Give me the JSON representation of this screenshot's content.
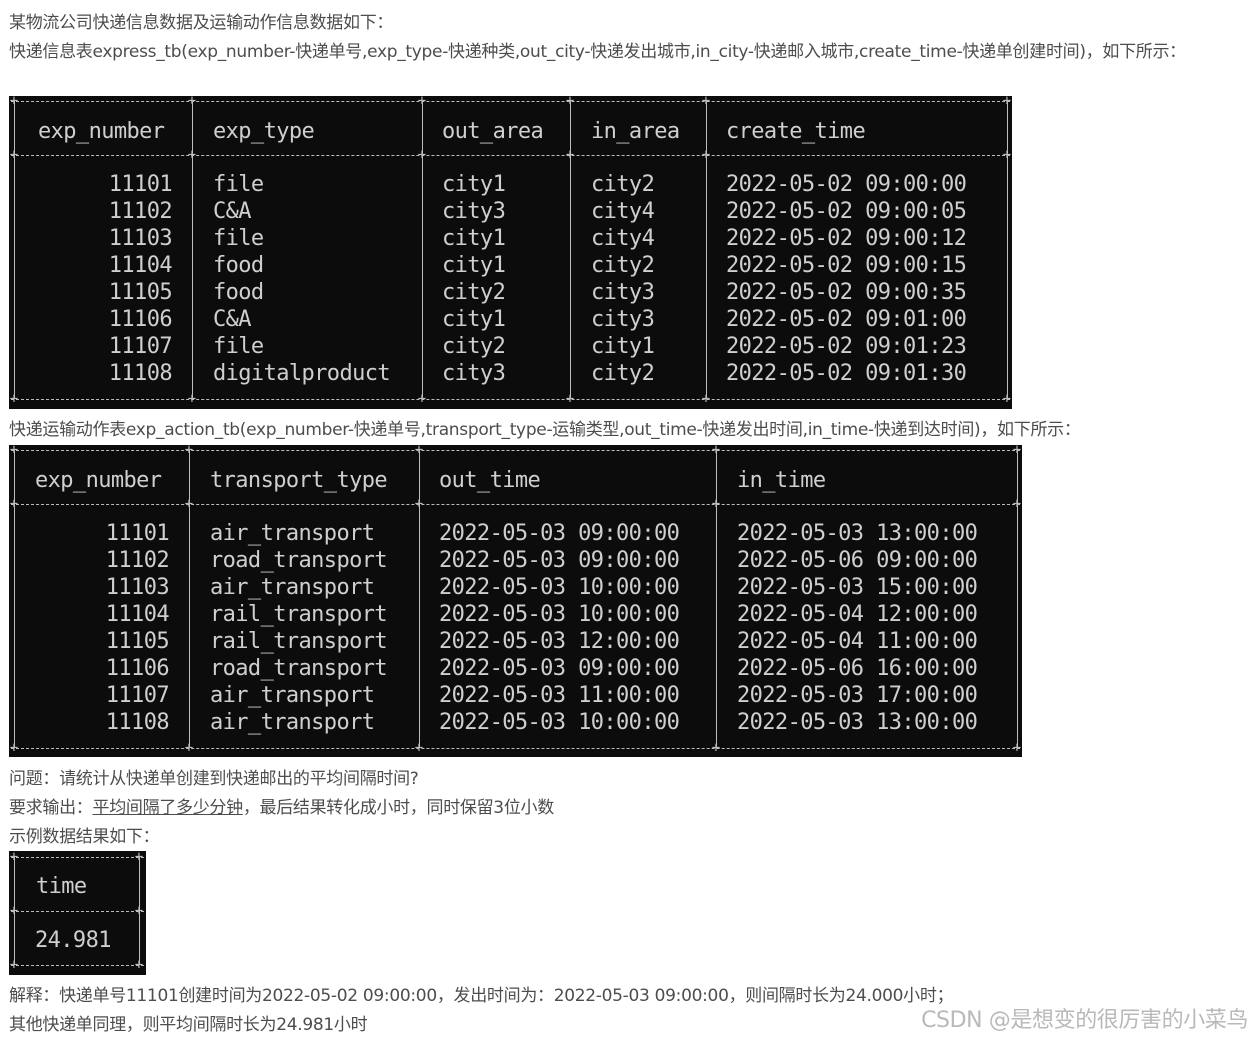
{
  "intro": "某物流公司快递信息数据及运输动作信息数据如下：",
  "express_desc": "快递信息表express_tb(exp_number-快递单号,exp_type-快递种类,out_city-快递发出城市,in_city-快递邮入城市,create_time-快递单创建时间)，如下所示：",
  "express_table": {
    "headers": [
      "exp_number",
      "exp_type",
      "out_area",
      "in_area",
      "create_time"
    ],
    "rows": [
      [
        "11101",
        "file",
        "city1",
        "city2",
        "2022-05-02 09:00:00"
      ],
      [
        "11102",
        "C&A",
        "city3",
        "city4",
        "2022-05-02 09:00:05"
      ],
      [
        "11103",
        "file",
        "city1",
        "city4",
        "2022-05-02 09:00:12"
      ],
      [
        "11104",
        "food",
        "city1",
        "city2",
        "2022-05-02 09:00:15"
      ],
      [
        "11105",
        "food",
        "city2",
        "city3",
        "2022-05-02 09:00:35"
      ],
      [
        "11106",
        "C&A",
        "city1",
        "city3",
        "2022-05-02 09:01:00"
      ],
      [
        "11107",
        "file",
        "city2",
        "city1",
        "2022-05-02 09:01:23"
      ],
      [
        "11108",
        "digitalproduct",
        "city3",
        "city2",
        "2022-05-02 09:01:30"
      ]
    ]
  },
  "action_desc": "快递运输动作表exp_action_tb(exp_number-快递单号,transport_type-运输类型,out_time-快递发出时间,in_time-快递到达时间)，如下所示：",
  "action_table": {
    "headers": [
      "exp_number",
      "transport_type",
      "out_time",
      "in_time"
    ],
    "rows": [
      [
        "11101",
        "air_transport",
        "2022-05-03 09:00:00",
        "2022-05-03 13:00:00"
      ],
      [
        "11102",
        "road_transport",
        "2022-05-03 09:00:00",
        "2022-05-06 09:00:00"
      ],
      [
        "11103",
        "air_transport",
        "2022-05-03 10:00:00",
        "2022-05-03 15:00:00"
      ],
      [
        "11104",
        "rail_transport",
        "2022-05-03 10:00:00",
        "2022-05-04 12:00:00"
      ],
      [
        "11105",
        "rail_transport",
        "2022-05-03 12:00:00",
        "2022-05-04 11:00:00"
      ],
      [
        "11106",
        "road_transport",
        "2022-05-03 09:00:00",
        "2022-05-06 16:00:00"
      ],
      [
        "11107",
        "air_transport",
        "2022-05-03 11:00:00",
        "2022-05-03 17:00:00"
      ],
      [
        "11108",
        "air_transport",
        "2022-05-03 10:00:00",
        "2022-05-03 13:00:00"
      ]
    ]
  },
  "question": "问题：请统计从快递单创建到快递邮出的平均间隔时间?",
  "requirement_prefix": "要求输出：",
  "requirement_underlined": "平均间隔了多少分钟",
  "requirement_suffix": "，最后结果转化成小时，同时保留3位小数",
  "sample_label": "示例数据结果如下：",
  "result_table": {
    "header": "time",
    "value": "24.981"
  },
  "explanation_1": "解释：快递单号11101创建时间为2022-05-02 09:00:00，发出时间为：2022-05-03 09:00:00，则间隔时长为24.000小时；",
  "explanation_2": "其他快递单同理，则平均间隔时长为24.981小时",
  "watermark": "CSDN @是想变的很厉害的小菜鸟",
  "colors": {
    "text": "#4d4d4d",
    "terminal_bg": "#0c0c0c",
    "terminal_text": "#cfcfcf"
  }
}
